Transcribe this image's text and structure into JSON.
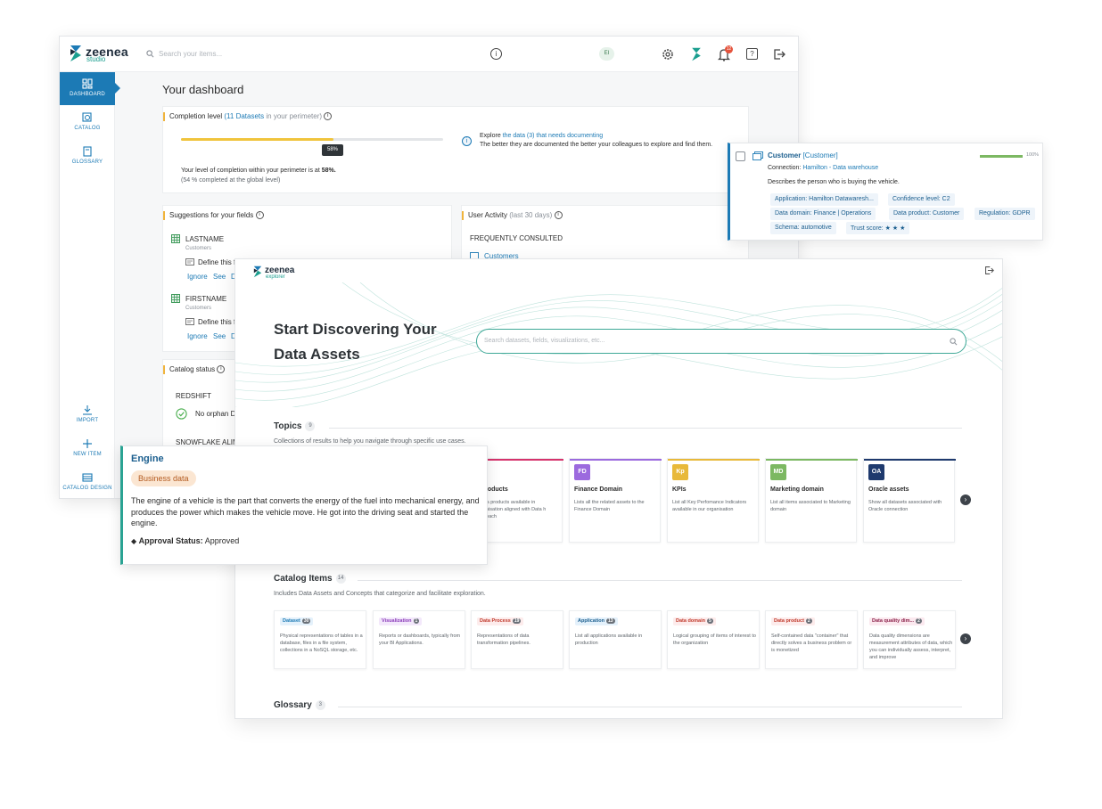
{
  "colors": {
    "primary": "#1c7ab5",
    "accent_teal": "#2aa393",
    "progress_yellow": "#f0c43c",
    "brand_dark": "#1d2b3a",
    "success_green": "#7cb862"
  },
  "studio": {
    "logo": {
      "name": "zeenea",
      "sub": "studio"
    },
    "search_placeholder": "Search your items...",
    "avatar_initials": "EI",
    "notification_count": "12",
    "sidebar": {
      "items": [
        {
          "label": "DASHBOARD",
          "icon": "dashboard-icon",
          "active": true
        },
        {
          "label": "CATALOG",
          "icon": "catalog-icon"
        },
        {
          "label": "GLOSSARY",
          "icon": "glossary-icon"
        },
        {
          "label": "IMPORT",
          "icon": "import-icon"
        },
        {
          "label": "NEW ITEM",
          "icon": "plus-icon"
        },
        {
          "label": "CATALOG DESIGN",
          "icon": "catalog-design-icon"
        }
      ]
    },
    "page_title": "Your dashboard",
    "completion": {
      "title": "Completion level",
      "datasets_link": "(11 Datasets",
      "perimeter_suffix": " in your perimeter)",
      "progress": 58,
      "tooltip": "58%",
      "summary_prefix": "Your level of completion within your perimeter is at ",
      "summary_value": "58%.",
      "global_note": "(54 % completed at the global level)",
      "explore_prefix": "Explore ",
      "explore_link": "the data (3) that needs documenting",
      "explore_line2": "The better they are documented the better your colleagues to explore and find them."
    },
    "suggestions": {
      "title": "Suggestions for your fields",
      "items": [
        {
          "name": "LASTNAME",
          "sub": "Customers",
          "action": "Define this f",
          "links": [
            "Ignore",
            "See",
            "D"
          ]
        },
        {
          "name": "FIRSTNAME",
          "sub": "Customers",
          "action": "Define this f",
          "links": [
            "Ignore",
            "See",
            "D"
          ]
        }
      ]
    },
    "user_activity": {
      "title": "User Activity",
      "period": "(last 30 days)",
      "section": "FREQUENTLY CONSULTED",
      "first_item": "Customers"
    },
    "catalog_status": {
      "title": "Catalog status",
      "sources": [
        "REDSHIFT",
        "SNOWFLAKE ALIM"
      ],
      "redshift_status": "No orphan D"
    }
  },
  "customer_card": {
    "name": "Customer",
    "bracket": "[Customer]",
    "progress": 100,
    "progress_label": "100%",
    "connection_label": "Connection: ",
    "connection_value": "Hamilton - Data warehouse",
    "description": "Describes the person who is buying the vehicle.",
    "tags": [
      "Application: Hamilton Datawaresh...",
      "Confidence level: C2",
      "Data domain: Finance | Operations",
      "Data product: Customer",
      "Regulation: GDPR",
      "Schema: automotive",
      "Trust score: ★ ★ ★"
    ]
  },
  "explorer": {
    "logo": {
      "name": "zeenea",
      "sub": "explorer"
    },
    "hero_title_line1": "Start Discovering Your",
    "hero_title_line2": "Data Assets",
    "search_placeholder": "Search datasets, fields, visualizations, etc...",
    "topics": {
      "title": "Topics",
      "count": "9",
      "description": "Collections of results to help you navigate through specific use cases.",
      "cards": [
        {
          "badge": "",
          "color": "#d6336c",
          "name": "a products",
          "desc": "ll data products available in organisation aligned with Data h approach"
        },
        {
          "badge": "FD",
          "color": "#9c6ade",
          "name": "Finance Domain",
          "desc": "Lists all the related assets to the Finance Domain"
        },
        {
          "badge": "Kp",
          "color": "#e8b93a",
          "name": "KPIs",
          "desc": "List all Key Perfomance Indicators available in our organisation"
        },
        {
          "badge": "MD",
          "color": "#7cb862",
          "name": "Marketing domain",
          "desc": "List all items associated to Marketing domain"
        },
        {
          "badge": "OA",
          "color": "#1f3a6e",
          "name": "Oracle assets",
          "desc": "Show all datasets associated with Oracle connection"
        }
      ]
    },
    "catalog_items": {
      "title": "Catalog Items",
      "count": "14",
      "description": "Includes Data Assets and Concepts that categorize and facilitate exploration.",
      "cards": [
        {
          "label": "Dataset",
          "count": "30",
          "bg": "#e4f1fb",
          "fg": "#1c7ab5",
          "desc": "Physical representations of tables in a database, files in a file system, collections in a NoSQL storage, etc."
        },
        {
          "label": "Visualization",
          "count": "1",
          "bg": "#f3e8fb",
          "fg": "#8a3ab9",
          "desc": "Reports or dashboards, typically from your BI Applications."
        },
        {
          "label": "Data Process",
          "count": "19",
          "bg": "#fdecec",
          "fg": "#c0392b",
          "desc": "Representations of data transformation pipelines."
        },
        {
          "label": "Application",
          "count": "13",
          "bg": "#e4f1fb",
          "fg": "#1c5f8f",
          "desc": "List all applications available in production"
        },
        {
          "label": "Data domain",
          "count": "5",
          "bg": "#fdecec",
          "fg": "#c0392b",
          "desc": "Logical grouping of items of interest to the organization"
        },
        {
          "label": "Data product",
          "count": "2",
          "bg": "#fdecec",
          "fg": "#c0392b",
          "desc": "Self-contained data \"container\" that directly solves a business problem or is monetized"
        },
        {
          "label": "Data quality dim...",
          "count": "2",
          "bg": "#fbe9ef",
          "fg": "#8b2049",
          "desc": "Data quality dimensions are measurement attributes of data, which you can individually assess, interpret, and improve"
        }
      ]
    },
    "glossary": {
      "title": "Glossary",
      "count": "3"
    }
  },
  "engine_card": {
    "title": "Engine",
    "badge": "Business data",
    "description": "The engine of a vehicle is the part that converts the energy of the fuel into mechanical energy, and produces the power which makes the vehicle move. He got into the driving seat and started the engine.",
    "status_label": "Approval Status:",
    "status_value": "Approved"
  }
}
